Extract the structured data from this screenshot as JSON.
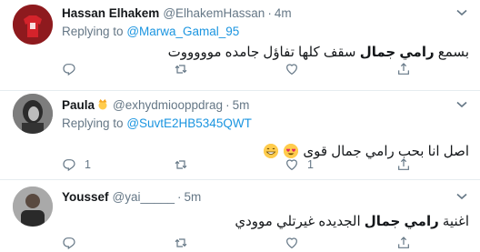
{
  "tweets": [
    {
      "name": "Hassan Elhakem",
      "handle": "@ElhakemHassan",
      "time": "4m",
      "replying_label": "Replying to",
      "replying_to": "@Marwa_Gamal_95",
      "text_before": "بسمع",
      "text_bold": "رامي جمال",
      "text_after": "سقف كلها تفاؤل جامده موووووت",
      "reply_count": "",
      "like_count": ""
    },
    {
      "name": "Paula",
      "handle": "@exhydmiooppdrag",
      "time": "5m",
      "replying_label": "Replying to",
      "replying_to": "@SuvtE2HB5345QWT",
      "text": "اصل انا بحب رامي جمال قوى",
      "reply_count": "1",
      "like_count": "1"
    },
    {
      "name": "Youssef",
      "handle": "@yai_____",
      "time": "5m",
      "text_before": "اغنية",
      "text_bold": "رامي جمال",
      "text_after": "الجديده غيرتلي موودي"
    }
  ],
  "separator": "·",
  "colors": {
    "link": "#1b95e0",
    "muted": "#657786",
    "divider": "#e6ecf0"
  },
  "icons": [
    "chevron-down-icon",
    "reply-icon",
    "retweet-icon",
    "like-icon",
    "share-icon",
    "crown-emoji-icon",
    "grin-emoji-icon",
    "heart-eyes-emoji-icon"
  ]
}
